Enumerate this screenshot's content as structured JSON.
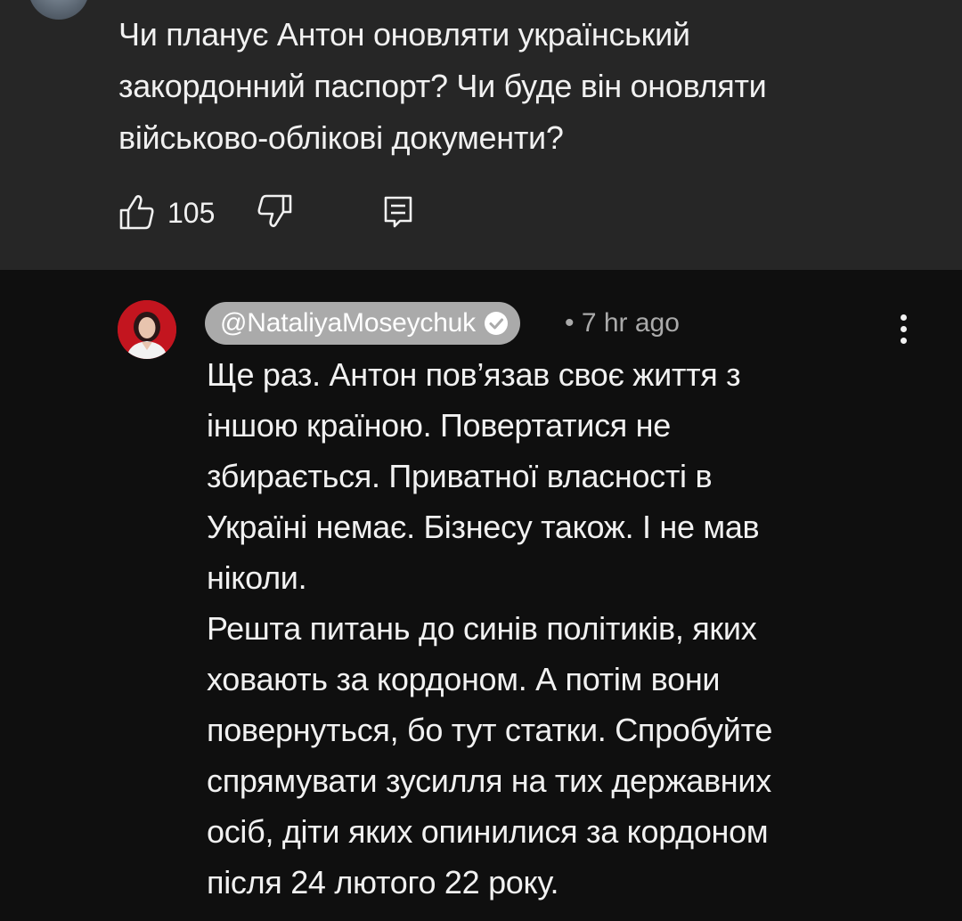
{
  "parent_comment": {
    "text": "Чи планує Антон оновляти український\nзакордонний паспорт? Чи буде він оновляти\nвійськово-облікові документи?",
    "like_count": "105"
  },
  "reply": {
    "author": "@NataliyaMoseychuk",
    "verified": true,
    "time": "• 7 hr ago",
    "text": "Ще раз. Антон пов’язав своє життя з\nіншою країною. Повертатися не\nзбирається. Приватної власності в\nУкраїні немає. Бізнесу також. І не мав\nніколи.\nРешта питань до синів політиків, яких\nховають за кордоном. А потім вони\nповернуться, бо тут статки. Спробуйте\nспрямувати зусилля на тих державних\nосіб, діти яких опинилися за кордоном\nпісля 24 лютого 22 року."
  },
  "icons": {
    "like": "thumbs-up-icon",
    "dislike": "thumbs-down-icon",
    "reply": "reply-comment-icon",
    "menu": "vertical-dots-icon",
    "verified": "verified-check-icon"
  },
  "colors": {
    "parent_background": "#262626",
    "reply_background": "#0f0f0f",
    "author_chip": "#aaaaaa",
    "text": "#f1f1f1",
    "muted_text": "#aaaaaa"
  }
}
